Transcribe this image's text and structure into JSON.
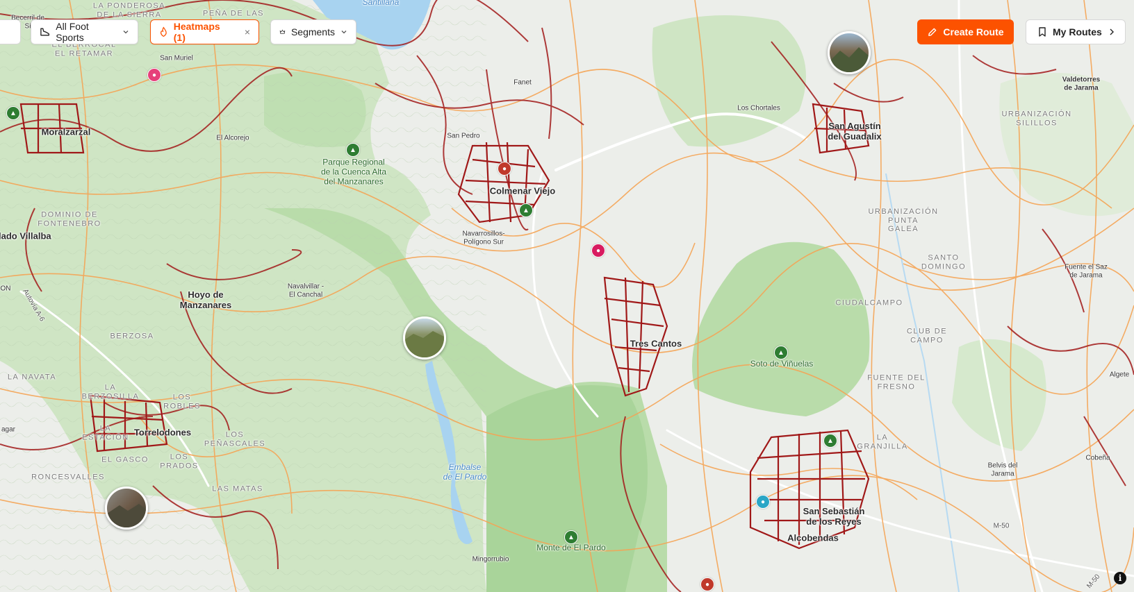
{
  "colors": {
    "accent": "#fc5200",
    "forest": "#c9e3be",
    "forest_dark": "#9fd08f",
    "water": "#a8d3f0",
    "heat_low": "#f7b26b",
    "heat_high": "#a21a1a",
    "poi_green": "#2e7d32",
    "poi_shop": "#d81b60",
    "poi_food": "#e6407a",
    "poi_rest": "#c0392b",
    "poi_tool": "#2aa6c6"
  },
  "toolbar": {
    "sport_filter": {
      "label": "All Foot Sports",
      "icon": "shoe-icon"
    },
    "heatmaps": {
      "label": "Heatmaps (1)",
      "icon": "flame-icon",
      "close": "×"
    },
    "segments": {
      "label": "Segments",
      "icon": "segment-crown-icon"
    },
    "create_route": {
      "label": "Create Route",
      "icon": "pencil-icon"
    },
    "my_routes": {
      "label": "My Routes",
      "icon": "bookmark-icon"
    }
  },
  "map": {
    "towns": [
      {
        "name": "Colmenar Viejo"
      },
      {
        "name": "Tres Cantos"
      },
      {
        "name": "San Agustín\ndel Guadalix"
      },
      {
        "name": "Moralzarzal"
      },
      {
        "name": "Torrelodones"
      },
      {
        "name": "Hoyo de\nManzanares"
      },
      {
        "name": "San Sebastián\nde los Reyes"
      },
      {
        "name": "Alcobendas"
      },
      {
        "name": "llado Villalba"
      }
    ],
    "villages": [
      {
        "name": "San Muriel"
      },
      {
        "name": "El Alcorejo"
      },
      {
        "name": "San Pedro"
      },
      {
        "name": "Fanet"
      },
      {
        "name": "Los Chortales"
      },
      {
        "name": "Navarrosillos-\nPolígono Sur"
      },
      {
        "name": "Navalvillar -\nEl Canchal"
      },
      {
        "name": "Valdetorres\nde Jarama"
      },
      {
        "name": "Fuente el Saz\nde Jarama"
      },
      {
        "name": "Algete"
      },
      {
        "name": "Cobeña"
      },
      {
        "name": "Belvis del\nJarama"
      },
      {
        "name": "Mingorrubio"
      },
      {
        "name": "agar"
      },
      {
        "name": "ON"
      },
      {
        "name": "Becerril de\nSi"
      }
    ],
    "districts": [
      {
        "name": "LA PONDEROSA\nDE LA SIERRA"
      },
      {
        "name": "PEÑA DE LAS"
      },
      {
        "name": "EL BERROCAL\nEL RETAMAR"
      },
      {
        "name": "DOMINIO DE\nFONTENEBRO"
      },
      {
        "name": "BERZOSA"
      },
      {
        "name": "LA NAVATA"
      },
      {
        "name": "LA\nBERZOSILLA"
      },
      {
        "name": "LOS\nROBLES"
      },
      {
        "name": "LA\nESTACIÓN"
      },
      {
        "name": "LOS\nPEÑASCALES"
      },
      {
        "name": "EL GASCO"
      },
      {
        "name": "LOS\nPRADOS"
      },
      {
        "name": "RONCESVALLES"
      },
      {
        "name": "LAS MATAS"
      },
      {
        "name": "URBANIZACIÓN\nSILILLOS"
      },
      {
        "name": "URBANIZACIÓN\nPUNTA\nGALEA"
      },
      {
        "name": "SANTO\nDOMINGO"
      },
      {
        "name": "CIUDALCAMPO"
      },
      {
        "name": "CLUB DE\nCAMPO"
      },
      {
        "name": "FUENTE DEL\nFRESNO"
      },
      {
        "name": "LA\nGRANJILLA"
      }
    ],
    "parks": [
      {
        "name": "Parque Regional\nde la Cuenca Alta\ndel Manzanares"
      },
      {
        "name": "Soto de Viñuelas"
      },
      {
        "name": "Monte de El Pardo"
      }
    ],
    "water": [
      {
        "name": "Embalse\nde El Pardo"
      },
      {
        "name": "Santillana"
      }
    ],
    "roads": [
      {
        "name": "Autovía A-6"
      },
      {
        "name": "M-50"
      },
      {
        "name": "M-50"
      }
    ],
    "photos": [
      {
        "name": "photo-gorge"
      },
      {
        "name": "photo-valley"
      },
      {
        "name": "photo-rocks"
      }
    ]
  },
  "attribution": {
    "label": "i"
  }
}
